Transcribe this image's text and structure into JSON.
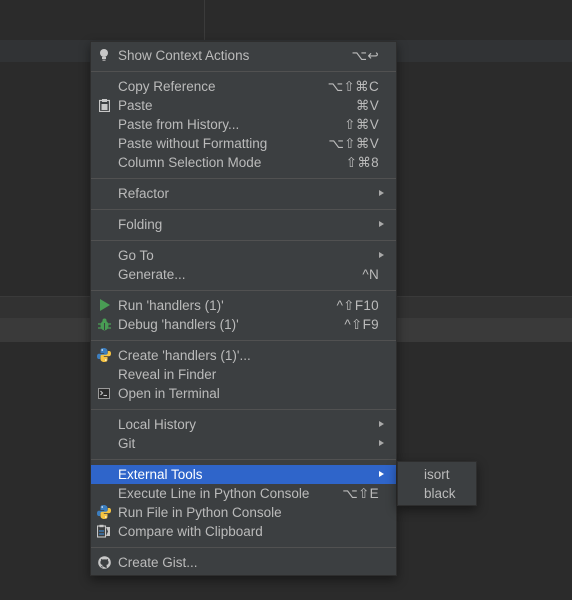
{
  "colors": {
    "menu_bg": "#3c3f41",
    "selection": "#2f65ca",
    "text": "#bbbbbb",
    "run_green": "#499c54",
    "python_blue": "#3c7ebf",
    "python_yellow": "#f5c342"
  },
  "context_menu": {
    "items": [
      {
        "label": "Show Context Actions",
        "shortcut": "⌥↩",
        "icon": "bulb-icon"
      },
      {
        "label": "Copy Reference",
        "shortcut": "⌥⇧⌘C"
      },
      {
        "label": "Paste",
        "shortcut": "⌘V",
        "icon": "clipboard-icon"
      },
      {
        "label": "Paste from History...",
        "shortcut": "⇧⌘V"
      },
      {
        "label": "Paste without Formatting",
        "shortcut": "⌥⇧⌘V"
      },
      {
        "label": "Column Selection Mode",
        "shortcut": "⇧⌘8"
      },
      {
        "label": "Refactor",
        "submenu": true
      },
      {
        "label": "Folding",
        "submenu": true
      },
      {
        "label": "Go To",
        "submenu": true
      },
      {
        "label": "Generate...",
        "shortcut": "^N"
      },
      {
        "label": "Run 'handlers (1)'",
        "shortcut": "^⇧F10",
        "icon": "run-icon"
      },
      {
        "label": "Debug 'handlers (1)'",
        "shortcut": "^⇧F9",
        "icon": "debug-icon"
      },
      {
        "label": "Create 'handlers (1)'...",
        "icon": "python-icon"
      },
      {
        "label": "Reveal in Finder"
      },
      {
        "label": "Open in Terminal",
        "icon": "terminal-icon"
      },
      {
        "label": "Local History",
        "submenu": true
      },
      {
        "label": "Git",
        "submenu": true
      },
      {
        "label": "External Tools",
        "submenu": true,
        "selected": true
      },
      {
        "label": "Execute Line in Python Console",
        "shortcut": "⌥⇧E"
      },
      {
        "label": "Run File in Python Console",
        "icon": "python-icon"
      },
      {
        "label": "Compare with Clipboard",
        "icon": "compare-icon"
      },
      {
        "label": "Create Gist...",
        "icon": "github-icon"
      }
    ]
  },
  "external_tools_submenu": {
    "items": [
      {
        "label": "isort"
      },
      {
        "label": "black"
      }
    ]
  }
}
